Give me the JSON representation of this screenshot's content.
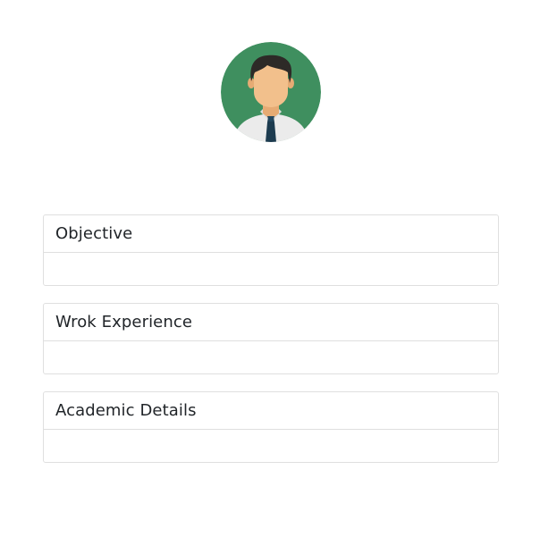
{
  "profile": {
    "avatar_icon": "person-avatar-icon",
    "colors": {
      "background": "#3f8f5f",
      "skin": "#f2c08c",
      "hair": "#2d2a27",
      "shirt": "#ebebeb",
      "tie": "#1c3b4f"
    }
  },
  "sections": [
    {
      "title": "Objective",
      "content": ""
    },
    {
      "title": "Wrok Experience",
      "content": ""
    },
    {
      "title": "Academic Details",
      "content": ""
    }
  ],
  "colors": {
    "border": "#dfdfdf",
    "text": "#212529"
  }
}
